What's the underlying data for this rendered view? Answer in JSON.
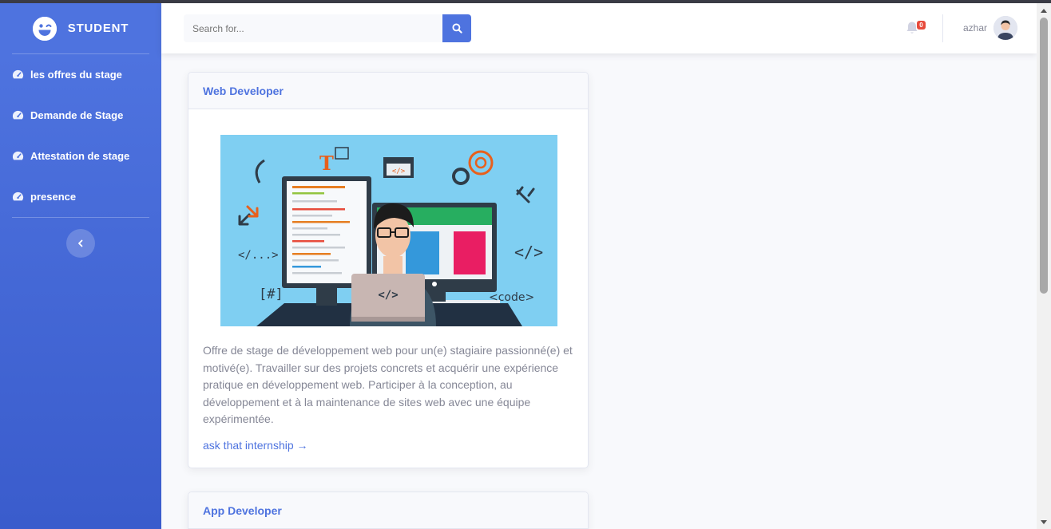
{
  "app": {
    "brand": "STUDENT"
  },
  "sidebar": {
    "items": [
      {
        "label": "les offres du stage",
        "icon": "tachometer-icon"
      },
      {
        "label": "Demande de Stage",
        "icon": "tachometer-icon"
      },
      {
        "label": "Attestation de stage",
        "icon": "tachometer-icon"
      },
      {
        "label": "presence",
        "icon": "tachometer-icon"
      }
    ],
    "toggle_icon": "chevron-left-icon"
  },
  "topbar": {
    "search": {
      "placeholder": "Search for...",
      "value": ""
    },
    "notifications": {
      "count": "0"
    },
    "user": {
      "name": "azhar"
    }
  },
  "cards": [
    {
      "title": "Web Developer",
      "image_labels": {
        "code_tag": "</...>",
        "hash": "[#]",
        "code": "<code>",
        "tag": "</>",
        "laptop": "</>",
        "screen": "</>",
        "letter": "T"
      },
      "description": "Offre de stage de développement web pour un(e) stagiaire passionné(e) et motivé(e). Travailler sur des projets concrets et acquérir une expérience pratique en développement web. Participer à la conception, au développement et à la maintenance de sites web avec une équipe expérimentée.",
      "link": "ask that internship →"
    },
    {
      "title": "App Developer"
    }
  ],
  "colors": {
    "primary": "#4e73df",
    "danger": "#e74a3b",
    "text_muted": "#858796",
    "background": "#f8f9fc"
  }
}
